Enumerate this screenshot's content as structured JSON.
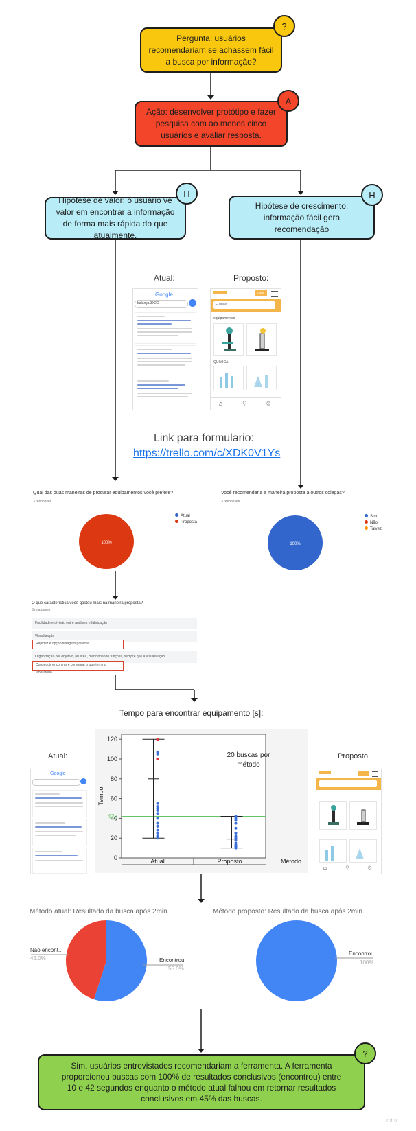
{
  "cards": {
    "question": "Pergunta: usuários recomendariam se achassem fácil a busca por informação?",
    "action": "Ação: desenvolver protótipo e fazer pesquisa com ao menos cinco usuários e avaliar resposta.",
    "hyp_value": "Hipótese de valor: o usuário vê valor em encontrar a informação de forma mais rápida do que atualmente.",
    "hyp_growth": "Hipótese de crescimento: informação fácil gera recomendação",
    "conclusion": "Sim, usuários entrevistados recomendariam a ferramenta. A ferramenta proporcionou buscas com 100% de resultados conclusivos (encontrou) entre 10 e 42 segundos enquanto o método atual falhou em retornar resultados conclusivos em 45% das buscas."
  },
  "badges": {
    "question": "?",
    "action": "A",
    "hyp_value": "H",
    "hyp_growth": "H",
    "conclusion": "?"
  },
  "colors": {
    "yellow": "#f9c80e",
    "red": "#f2452a",
    "cyan": "#b8ecf7",
    "green": "#8fd14f",
    "pie_red": "#dc3912",
    "pie_blue": "#3366cc",
    "gpie_red": "#ea4335",
    "gpie_blue": "#4285f4"
  },
  "mockups": {
    "atual_label": "Atual:",
    "proposto_label": "Proposto:",
    "google": "Google",
    "search_value": "balança 3X2G",
    "app_input": "Fullbox",
    "app_btn": "Login",
    "app_section1": "equipamentos",
    "app_section2": "QUÍMICA"
  },
  "link": {
    "title": "Link para formulario:",
    "url": "https://trello.com/c/XDK0V1Ys"
  },
  "form_left": {
    "question": "Qual das duas maneiras de procurar equipamentos você prefere?",
    "responses": "3 responses",
    "legend": [
      "Atual",
      "Proposta"
    ],
    "pct": "100%"
  },
  "form_right": {
    "question": "Você recomendaria a maneira proposta a outros colegas?",
    "responses": "3 responses",
    "legend": [
      "Sim",
      "Não",
      "Talvez"
    ],
    "pct": "100%"
  },
  "form_list": {
    "question": "O que característica você gostou mais na maneira proposta?",
    "responses": "3 responses",
    "rows": [
      "Facilidade e divisão entre análises e fabricação",
      "Visualização",
      "Rapidez e opção filtragem palavras",
      "Organização por objetivo, ou área, mencionando funções, sempre que a visualização",
      "Conseguir encontrar e comparar o que tem no laboratório"
    ]
  },
  "chart_title": "Tempo para encontrar equipamento [s]:",
  "chart_data": {
    "type": "scatter",
    "title": "",
    "xlabel": "Método",
    "ylabel": "Tempo",
    "categories": [
      "Atual",
      "Proposto"
    ],
    "yticks": [
      0,
      20,
      40,
      60,
      80,
      100,
      120
    ],
    "ylim": [
      0,
      125
    ],
    "reference_line": {
      "value": 42,
      "label": "42s",
      "color": "#66c266"
    },
    "annotation": "20 buscas por método",
    "series": [
      {
        "category": "Atual",
        "min": 20,
        "max": 120,
        "mean": 80,
        "points": [
          120,
          107,
          105,
          100,
          55,
          52,
          50,
          48,
          45,
          40,
          35,
          32,
          28,
          25,
          22,
          20
        ]
      },
      {
        "category": "Proposto",
        "min": 10,
        "max": 42,
        "mean": 19,
        "points": [
          42,
          40,
          38,
          35,
          30,
          25,
          22,
          20,
          18,
          15,
          13,
          12,
          11,
          10
        ]
      }
    ],
    "outliers_red": [
      120,
      100
    ]
  },
  "pies": {
    "left_title": "Método atual: Resultado da busca após 2min.",
    "right_title": "Método proposto: Resultado da busca após 2min.",
    "left": [
      {
        "label": "Não encont...",
        "pct": "45.0%",
        "value": 45
      },
      {
        "label": "Encontrou",
        "pct": "55.0%",
        "value": 55
      }
    ],
    "right": [
      {
        "label": "Encontrou",
        "pct": "100%",
        "value": 100
      }
    ]
  },
  "watermark": "miro"
}
